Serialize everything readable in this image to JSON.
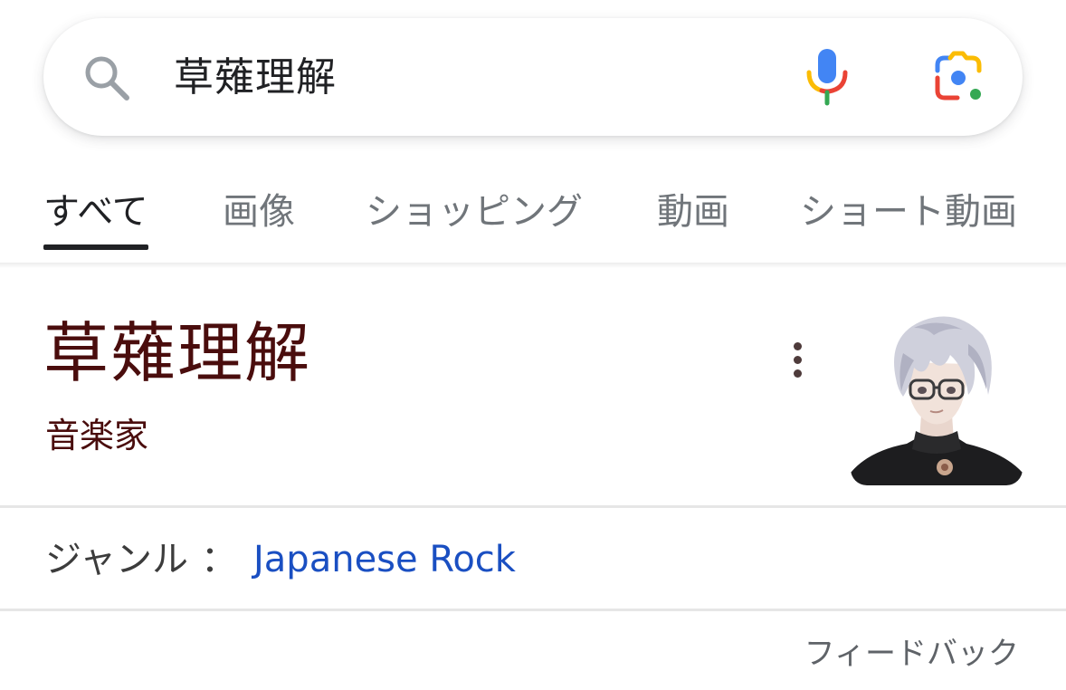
{
  "search": {
    "query": "草薙理解",
    "icons": {
      "search": "search-icon",
      "voice": "mic-icon",
      "lens": "camera-lens-icon"
    }
  },
  "tabs": [
    {
      "label": "すべて",
      "active": true
    },
    {
      "label": "画像",
      "active": false
    },
    {
      "label": "ショッピング",
      "active": false
    },
    {
      "label": "動画",
      "active": false
    },
    {
      "label": "ショート動画",
      "active": false
    }
  ],
  "knowledge_panel": {
    "title": "草薙理解",
    "subtitle": "音楽家",
    "more_icon": "more-vert-icon",
    "image": "anime-character-portrait",
    "genre": {
      "label": "ジャンル",
      "separator": "：",
      "value": "Japanese Rock"
    }
  },
  "feedback_label": "フィードバック",
  "colors": {
    "title": "#4a0d0d",
    "link": "#1a4fc2",
    "tab_inactive": "#70757a",
    "tab_active": "#202124"
  }
}
